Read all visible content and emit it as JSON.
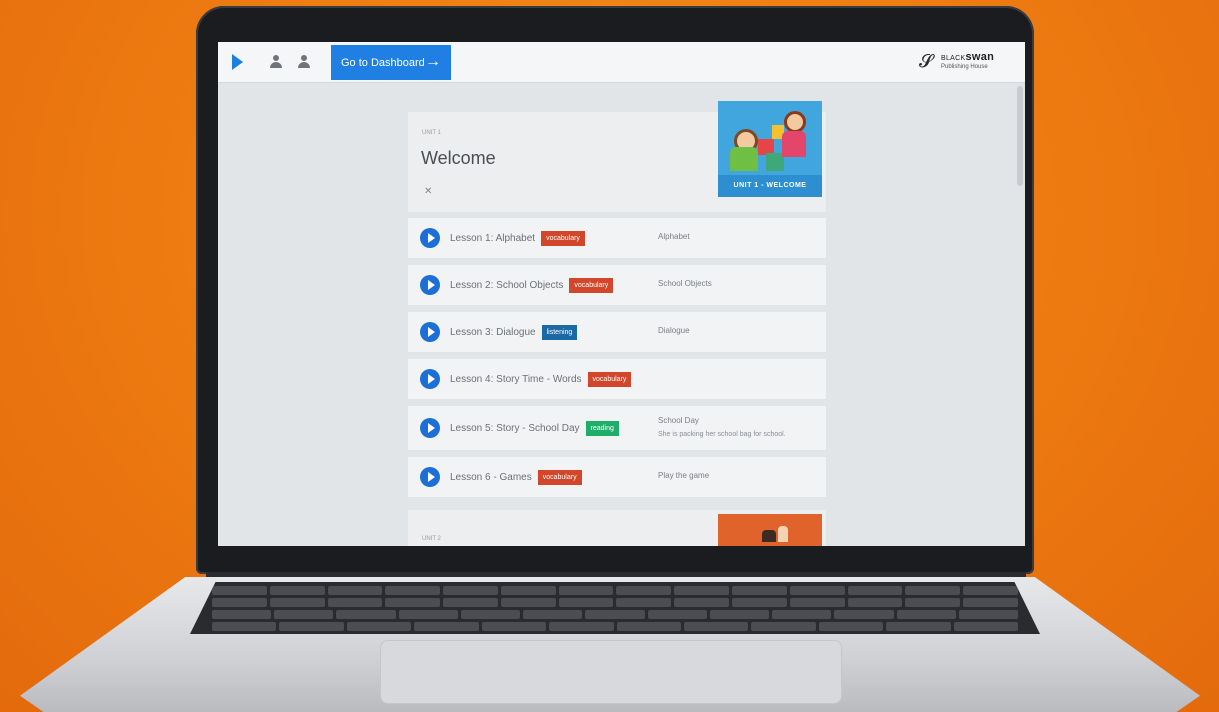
{
  "topbar": {
    "dashboard_label": "Go to Dashboard",
    "arrow_glyph": "→",
    "brand_prefix": "BLACK",
    "brand_name": "swan",
    "brand_sub": "Publishing House"
  },
  "unit": {
    "kicker": "UNIT 1",
    "title": "Welcome",
    "close_glyph": "✕",
    "thumb_label": "UNIT 1 - WELCOME"
  },
  "lessons": [
    {
      "title": "Lesson 1: Alphabet",
      "badge": "vocabulary",
      "badge_color": "#d2462b",
      "desc": "Alphabet",
      "desc2": ""
    },
    {
      "title": "Lesson 2: School Objects",
      "badge": "vocabulary",
      "badge_color": "#d2462b",
      "desc": "School Objects",
      "desc2": ""
    },
    {
      "title": "Lesson 3: Dialogue",
      "badge": "listening",
      "badge_color": "#1b6aa6",
      "desc": "Dialogue",
      "desc2": ""
    },
    {
      "title": "Lesson 4: Story Time - Words",
      "badge": "vocabulary",
      "badge_color": "#d2462b",
      "desc": "",
      "desc2": ""
    },
    {
      "title": "Lesson 5: Story - School Day",
      "badge": "reading",
      "badge_color": "#1fae6a",
      "desc": "School Day",
      "desc2": "She is packing her school bag for school."
    },
    {
      "title": "Lesson 6 - Games",
      "badge": "vocabulary",
      "badge_color": "#d2462b",
      "desc": "Play the game",
      "desc2": ""
    }
  ],
  "next_unit": {
    "kicker": "UNIT 2"
  },
  "colors": {
    "accent": "#1f7fe3",
    "background": "#ee7d12"
  },
  "icons": [
    "play-logo-icon",
    "user-icon",
    "bell-icon",
    "arrow-right-icon",
    "swan-logo-icon",
    "close-icon",
    "play-circle-icon"
  ]
}
